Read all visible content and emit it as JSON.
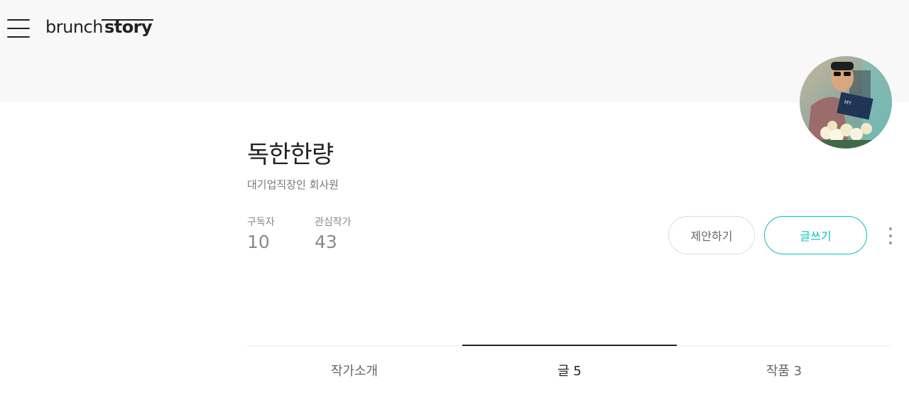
{
  "header": {
    "logo_part1": "brunch",
    "logo_part2": "story"
  },
  "author": {
    "name": "독한한량",
    "description": "대기업직장인 회사원"
  },
  "stats": {
    "subscribers_label": "구독자",
    "subscribers_count": "10",
    "interests_label": "관심작가",
    "interests_count": "43"
  },
  "actions": {
    "propose_label": "제안하기",
    "write_label": "글쓰기"
  },
  "tabs": [
    {
      "label": "작가소개",
      "active": false
    },
    {
      "label": "글 5",
      "active": true
    },
    {
      "label": "작품 3",
      "active": false
    }
  ],
  "colors": {
    "accent": "#00c3bd",
    "header_bg": "#f8f8f8"
  },
  "icons": {
    "menu": "hamburger-menu-icon",
    "more": "vertical-ellipsis-icon"
  }
}
